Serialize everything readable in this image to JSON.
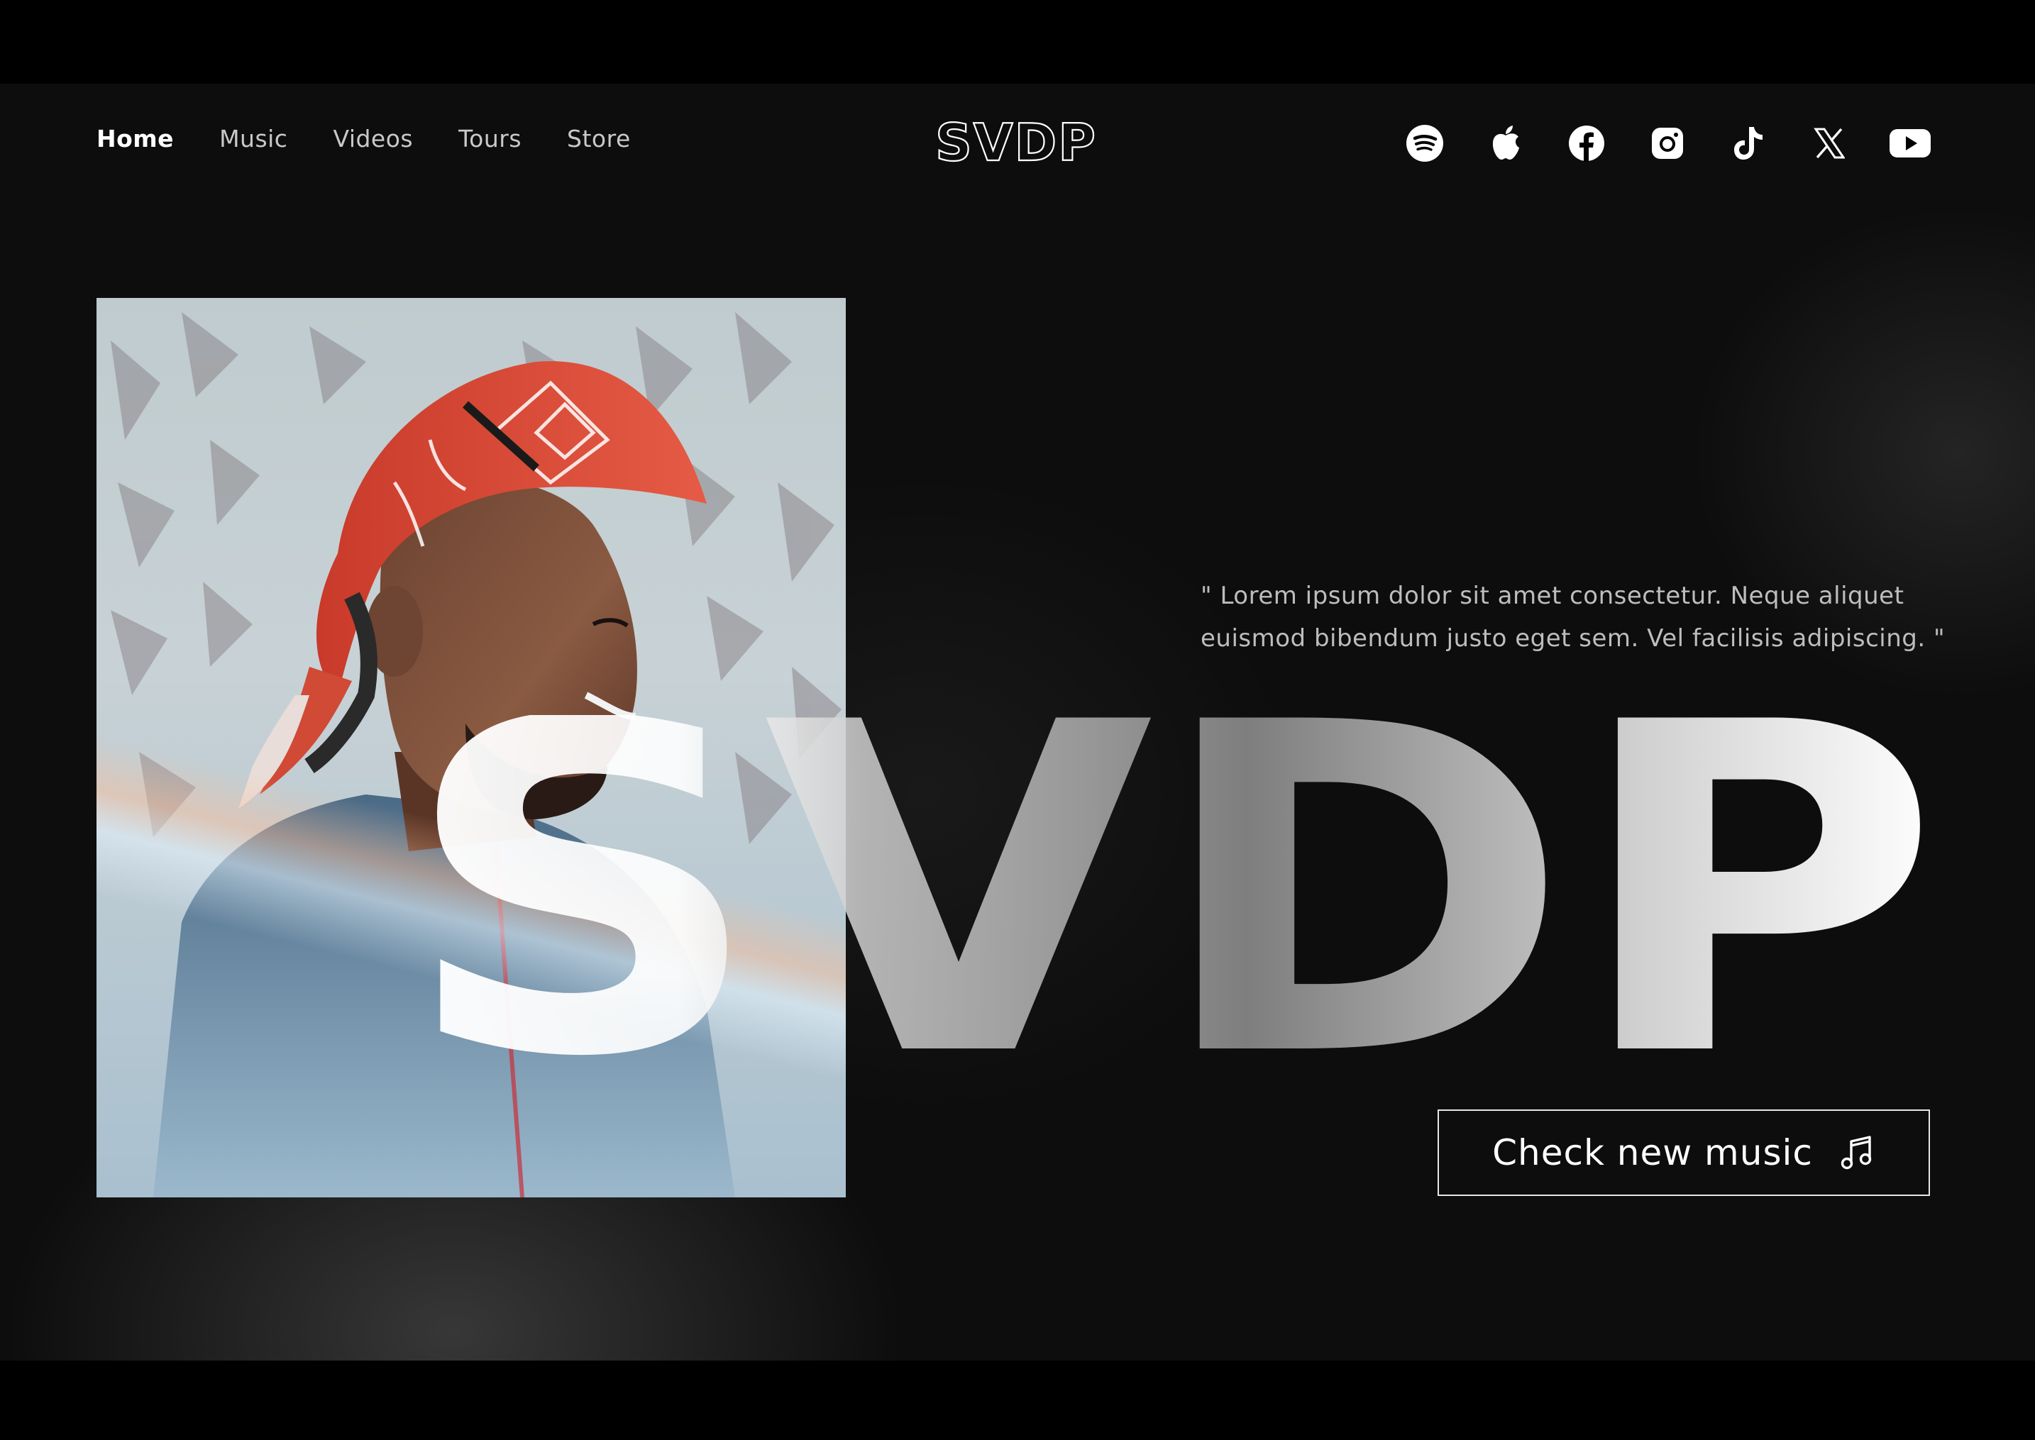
{
  "nav": {
    "items": [
      "Home",
      "Music",
      "Videos",
      "Tours",
      "Store"
    ],
    "active": "Home"
  },
  "brand": {
    "logo_text": "SVDP",
    "wordmark": "SVDP"
  },
  "socials": [
    "spotify-icon",
    "apple-icon",
    "facebook-icon",
    "instagram-icon",
    "tiktok-icon",
    "x-icon",
    "youtube-icon"
  ],
  "hero": {
    "quote_line1": "\" Lorem ipsum dolor sit amet consectetur. Neque aliquet",
    "quote_line2": "euismod bibendum justo eget sem. Vel facilisis adipiscing. \"",
    "cta_label": "Check new music",
    "cta_icon": "music-note-icon"
  },
  "colors": {
    "background": "#0d0d0d",
    "text": "#ffffff",
    "muted": "#bdbdbd",
    "bandana": "#e2503a"
  }
}
